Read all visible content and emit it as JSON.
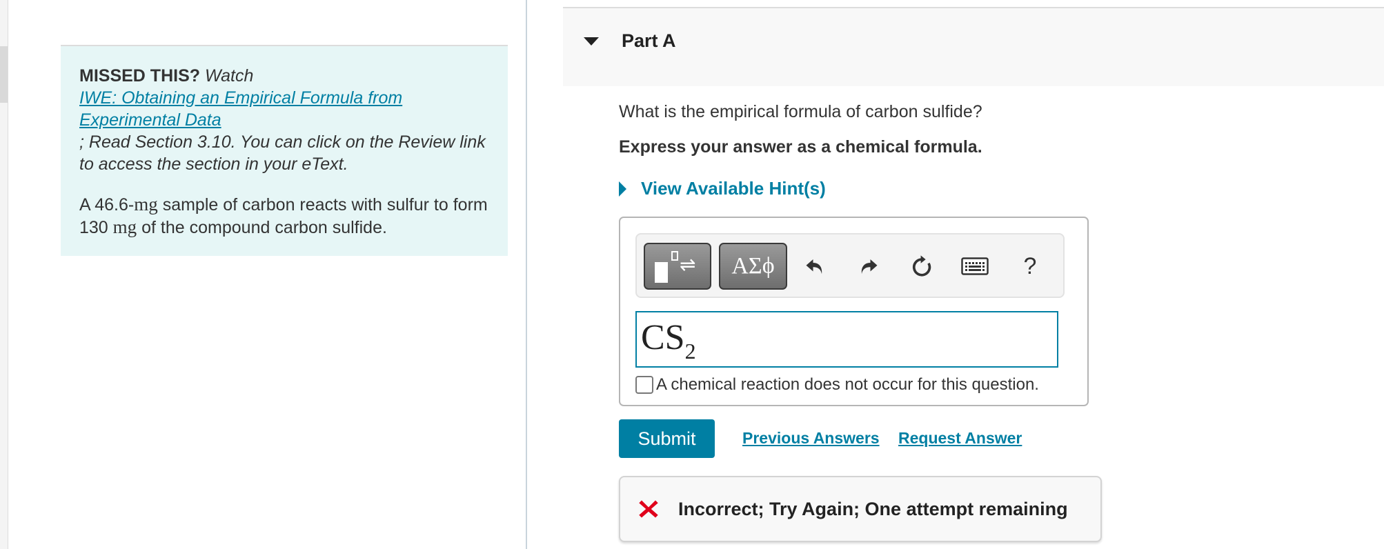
{
  "left_panel": {
    "missed_label": "MISSED THIS?",
    "watch_label": "Watch",
    "video_link": "IWE: Obtaining an Empirical Formula from Experimental Data",
    "read_text": "; Read Section 3.10. You can click on the Review link to access the section in your eText.",
    "problem": {
      "part1": "A 46.6-",
      "unit1": "mg",
      "part2": " sample of carbon reacts with sulfur to form 130 ",
      "unit2": "mg",
      "part3": " of the compound carbon sulfide."
    }
  },
  "part": {
    "title": "Part A",
    "question": "What is the empirical formula of carbon sulfide?",
    "instruction": "Express your answer as a chemical formula.",
    "hint_label": "View Available Hint(s)"
  },
  "toolbar": {
    "templates_icon": "templates-icon",
    "greek_label": "ΑΣϕ",
    "undo_icon": "undo-icon",
    "redo_icon": "redo-icon",
    "reset_icon": "reset-icon",
    "keyboard_icon": "keyboard-icon",
    "help_label": "?"
  },
  "answer": {
    "formula_base": "CS",
    "formula_subscript": "2",
    "no_reaction_label": "A chemical reaction does not occur for this question.",
    "no_reaction_checked": false
  },
  "actions": {
    "submit_label": "Submit",
    "previous_answers_label": "Previous Answers",
    "request_answer_label": "Request Answer"
  },
  "feedback": {
    "status": "incorrect",
    "message": "Incorrect; Try Again; One attempt remaining",
    "color": "#e0001b"
  },
  "colors": {
    "accent": "#007fa3",
    "info_bg": "#e6f6f6"
  }
}
